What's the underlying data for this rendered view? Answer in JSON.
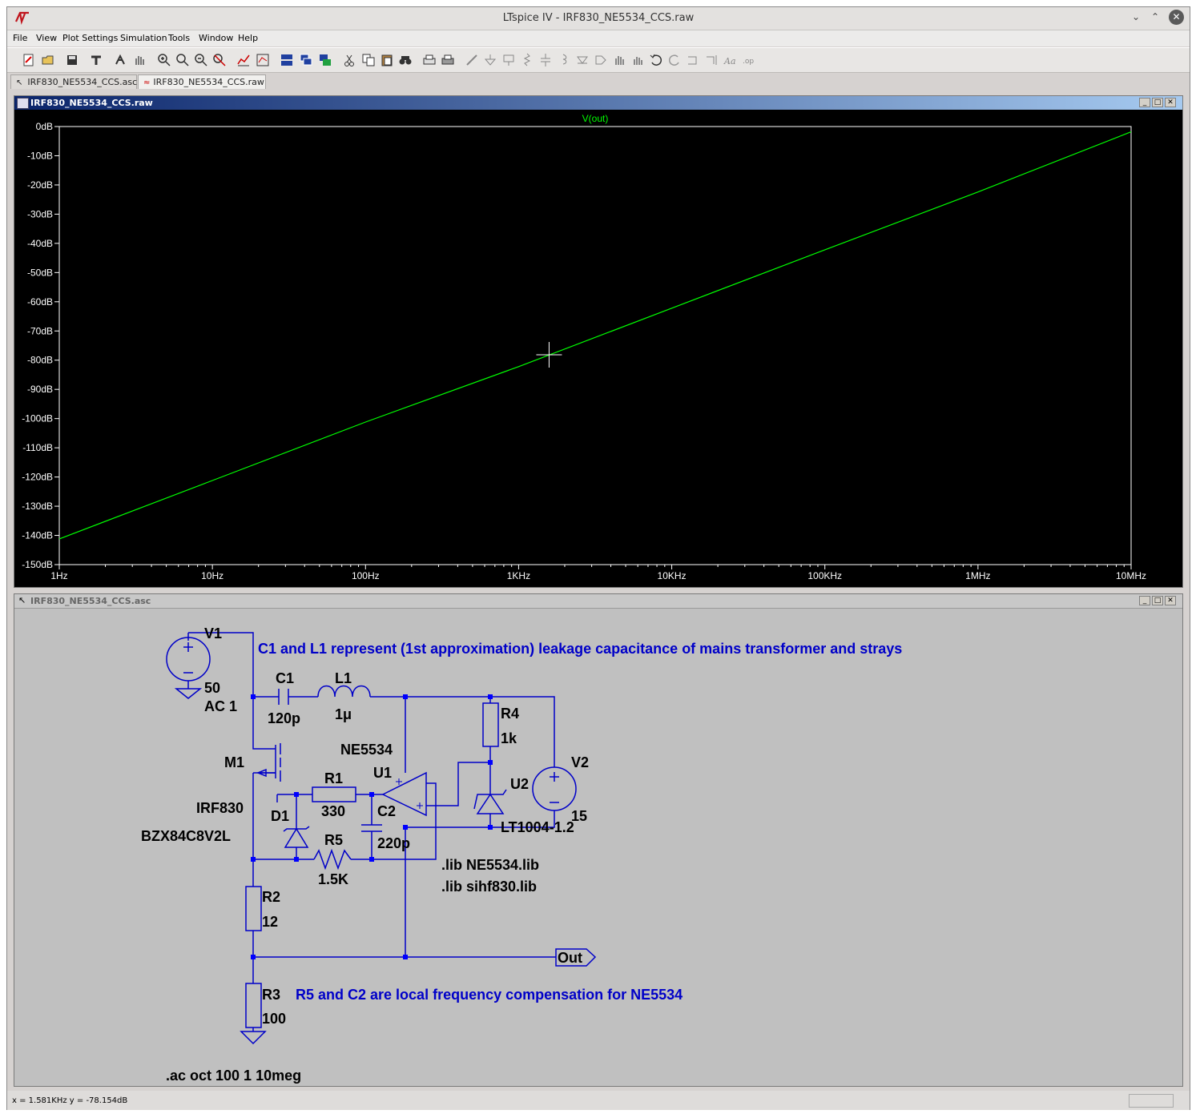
{
  "window": {
    "title": "LTspice IV - IRF830_NE5534_CCS.raw"
  },
  "menu": {
    "items": [
      "File",
      "View",
      "Plot Settings",
      "Simulation",
      "Tools",
      "Window",
      "Help"
    ]
  },
  "tabs": [
    {
      "label": "IRF830_NE5534_CCS.asc",
      "icon": "schematic-icon"
    },
    {
      "label": "IRF830_NE5534_CCS.raw",
      "icon": "waveform-icon"
    }
  ],
  "plot_window": {
    "title": "IRF830_NE5534_CCS.raw"
  },
  "schematic_window": {
    "title": "IRF830_NE5534_CCS.asc"
  },
  "chart_data": {
    "type": "line",
    "title": "V(out)",
    "xscale": "log",
    "xlim": [
      1,
      10000000
    ],
    "ylim": [
      -150,
      0
    ],
    "x_ticks": [
      "1Hz",
      "10Hz",
      "100Hz",
      "1KHz",
      "10KHz",
      "100KHz",
      "1MHz",
      "10MHz"
    ],
    "y_ticks": [
      "0dB",
      "-10dB",
      "-20dB",
      "-30dB",
      "-40dB",
      "-50dB",
      "-60dB",
      "-70dB",
      "-80dB",
      "-90dB",
      "-100dB",
      "-110dB",
      "-120dB",
      "-130dB",
      "-140dB",
      "-150dB"
    ],
    "series": [
      {
        "name": "V(out)",
        "color": "#00ff00",
        "x": [
          1,
          10,
          100,
          1000,
          10000,
          100000,
          1000000,
          10000000
        ],
        "y": [
          -141.2,
          -121.2,
          -101.2,
          -82.2,
          -62.2,
          -42.2,
          -22.4,
          -1.8
        ]
      }
    ],
    "cursor": {
      "x": 1581,
      "y": -78.154
    },
    "background": "#000000",
    "grid": false
  },
  "schematic": {
    "labels": {
      "v1": "V1",
      "v1_val": "50",
      "v1_ac": "AC 1",
      "c1": "C1",
      "c1_val": "120p",
      "l1": "L1",
      "l1_val": "1μ",
      "r4": "R4",
      "r4_val": "1k",
      "v2": "V2",
      "v2_val": "15",
      "u1_model": "NE5534",
      "u1": "U1",
      "u2": "U2",
      "u2_model": "LT1004-1.2",
      "m1": "M1",
      "m1_model": "IRF830",
      "d1": "D1",
      "d1_model": "BZX84C8V2L",
      "r1": "R1",
      "r1_val": "330",
      "c2": "C2",
      "c2_val": "220p",
      "r5": "R5",
      "r5_val": "1.5K",
      "r2": "R2",
      "r2_val": "12",
      "r3": "R3",
      "r3_val": "100",
      "out": "Out",
      "lib1": ".lib NE5534.lib",
      "lib2": ".lib sihf830.lib",
      "ac_cmd": ".ac oct 100 1 10meg"
    },
    "comments": {
      "c1_note": "C1 and L1 represent (1st approximation) leakage capacitance of mains transformer and strays",
      "r5_note": "R5 and C2 are local frequency compensation for NE5534"
    }
  },
  "status": {
    "text": "x = 1.581KHz    y = -78.154dB"
  },
  "colors": {
    "wire": "#0000c8",
    "node": "#0000ff",
    "trace": "#00ff00",
    "plot_bg": "#000000",
    "schematic_bg": "#c0c0c0"
  }
}
